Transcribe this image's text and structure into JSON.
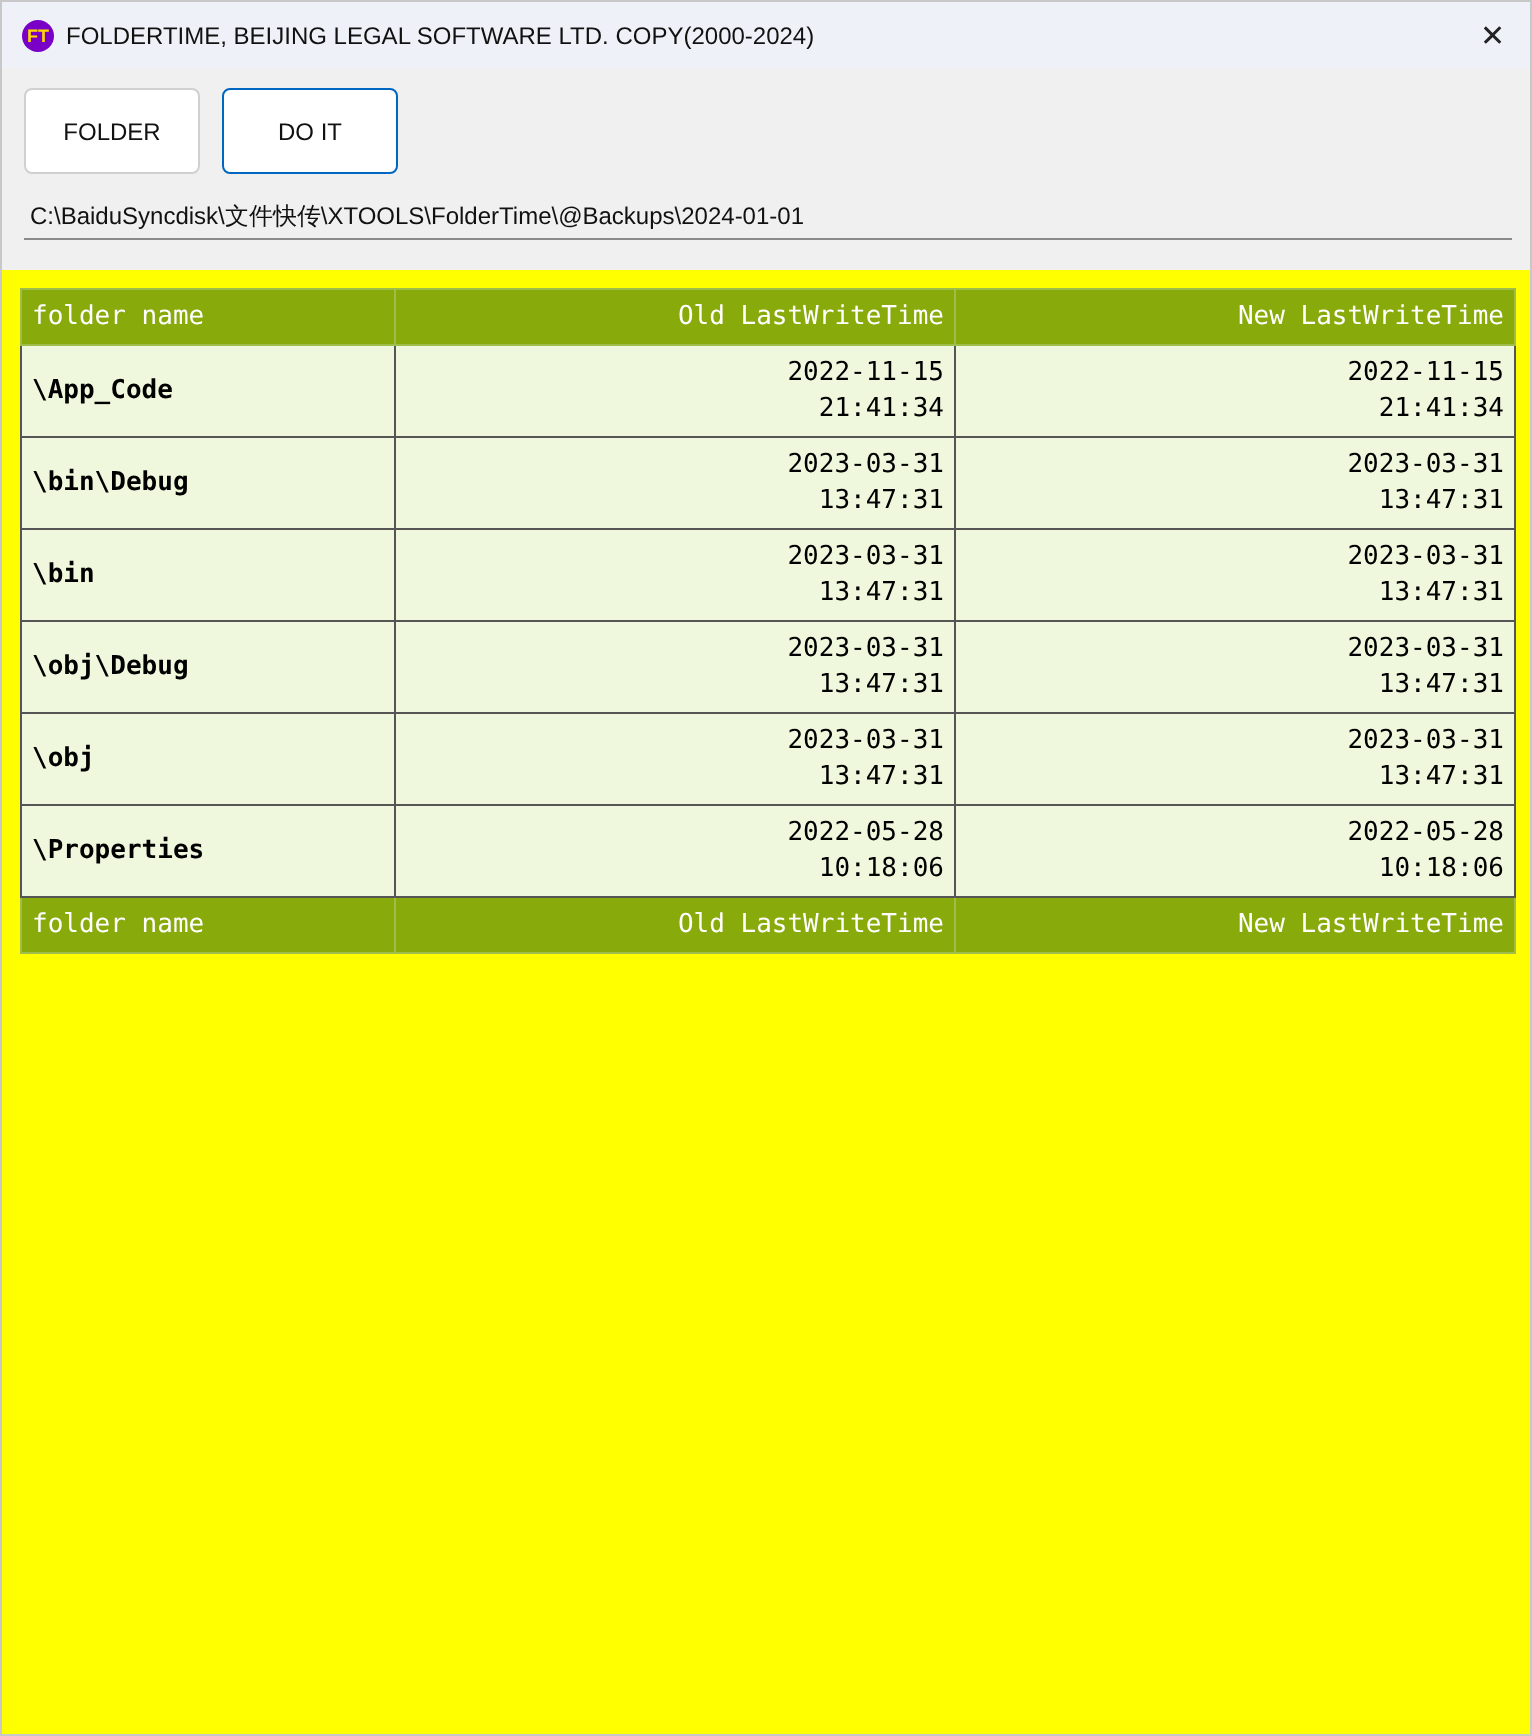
{
  "window": {
    "title": "FOLDERTIME, BEIJING LEGAL SOFTWARE LTD. COPY(2000-2024)",
    "logo": "FT",
    "close": "✕"
  },
  "buttons": [
    {
      "label": "FOLDER",
      "focused": false
    },
    {
      "label": "DO IT",
      "focused": true
    }
  ],
  "path_field": {
    "value": "C:\\BaiduSyncdisk\\文件快传\\XTOOLS\\FolderTime\\@Backups\\2024-01-01"
  },
  "table": {
    "columns": [
      "folder name",
      "Old LastWriteTime",
      "New LastWriteTime"
    ],
    "rows": [
      {
        "folder": "\\App_Code",
        "old": "2022-11-15 21:41:34",
        "new": "2022-11-15 21:41:34"
      },
      {
        "folder": "\\bin\\Debug",
        "old": "2023-03-31 13:47:31",
        "new": "2023-03-31 13:47:31"
      },
      {
        "folder": "\\bin",
        "old": "2023-03-31 13:47:31",
        "new": "2023-03-31 13:47:31"
      },
      {
        "folder": "\\obj\\Debug",
        "old": "2023-03-31 13:47:31",
        "new": "2023-03-31 13:47:31"
      },
      {
        "folder": "\\obj",
        "old": "2023-03-31 13:47:31",
        "new": "2023-03-31 13:47:31"
      },
      {
        "folder": "\\Properties",
        "old": "2022-05-28 10:18:06",
        "new": "2022-05-28 10:18:06"
      }
    ],
    "footer": [
      "folder name",
      "Old LastWriteTime",
      "New LastWriteTime"
    ]
  }
}
